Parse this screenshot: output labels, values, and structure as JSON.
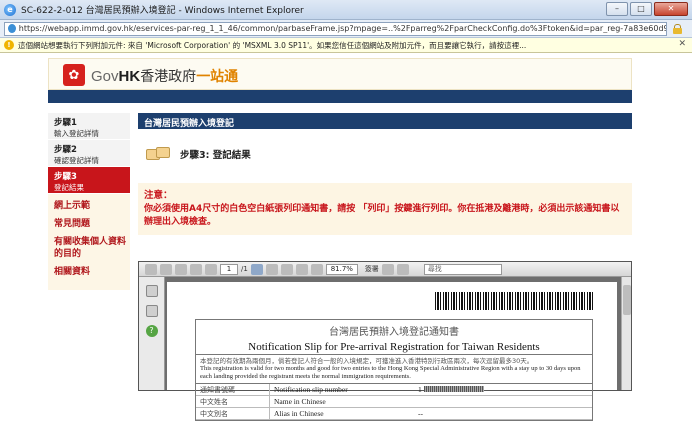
{
  "window": {
    "title": "SC-622-2-012 台灣居民預辦入境登記 - Windows Internet Explorer",
    "url": "https://webapp.immd.gov.hk/eservices-par-reg_1_1_46/common/parbaseFrame.jsp?mpage=..%2Fparreg%2FparCheckConfig.do%3Ftoken&id=par_reg-7a83e60d9eaf4a26ad83981b006a2",
    "controls": [
      "–",
      "□",
      "✕"
    ]
  },
  "infobar": {
    "message": "這個網站想要執行下列附加元件: 來自 'Microsoft Corporation' 的 'MSXML 3.0 SP11'。如果您信任這個網站及附加元件，而且要讓它執行，請按這裡..."
  },
  "logo": {
    "gov": "Gov",
    "hk": "HK",
    "zh": "香港政府",
    "accent": "一站通"
  },
  "steps": [
    {
      "title": "步驟1",
      "sub": "輸入登記詳情",
      "active": false
    },
    {
      "title": "步驟2",
      "sub": "確認登記詳情",
      "active": false
    },
    {
      "title": "步驟3",
      "sub": "登記結果",
      "active": true
    }
  ],
  "links": [
    "網上示範",
    "常見問題",
    "有關收集個人資料的目的",
    "相關資料"
  ],
  "main": {
    "section_title": "台灣居民預辦入境登記",
    "step_result": "步驟3: 登記結果",
    "notice_title": "注意：",
    "notice_body": "你必須使用A4尺寸的白色空白紙張列印通知書，請按 「列印」按鍵進行列印。你在抵港及離港時，必須出示該通知書以辦理出入境檢查。"
  },
  "pdf": {
    "page_current": "1",
    "page_total": "/1",
    "zoom": "81.7%",
    "sign_label": "簽署",
    "find_placeholder": "尋找",
    "doc": {
      "title_zh": "台灣居民預辦入境登記通知書",
      "title_en": "Notification Slip for Pre-arrival Registration for Taiwan Residents",
      "note_zh": "本登記的有效期為兩個月，倘若登記人符合一般的入境規定，可獲准進入香港特別行政區兩次，每次逗留最多30天。",
      "note_en": "This registration is valid for two months and good for two entries to the Hong Kong Special Administrative Region with a stay up to 30 days upon each landing provided the registrant meets the normal immigration requirements.",
      "rows": [
        {
          "zh": "通知書號碼",
          "en": "Notification slip number",
          "val": "1"
        },
        {
          "zh": "中文姓名",
          "en": "Name in Chinese",
          "val": ""
        },
        {
          "zh": "中文別名",
          "en": "Alias in Chinese",
          "val": "--"
        }
      ]
    }
  }
}
